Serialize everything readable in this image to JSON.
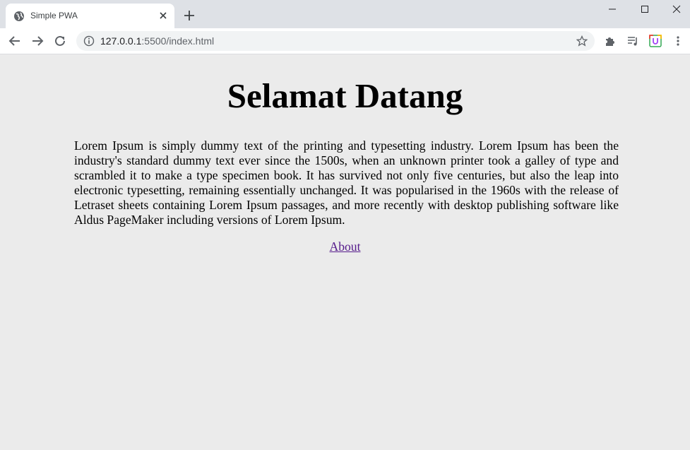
{
  "browser": {
    "tab": {
      "title": "Simple PWA",
      "favicon": "globe-icon"
    },
    "address_bar": {
      "host": "127.0.0.1",
      "rest": ":5500/index.html"
    },
    "icons": [
      "back-arrow-icon",
      "forward-arrow-icon",
      "reload-icon",
      "info-icon",
      "star-icon",
      "extensions-icon",
      "media-queue-icon",
      "extension-badge-icon",
      "kebab-menu-icon",
      "minimize-icon",
      "maximize-icon",
      "close-icon",
      "plus-icon"
    ]
  },
  "page": {
    "heading": "Selamat Datang",
    "paragraph": "Lorem Ipsum is simply dummy text of the printing and typesetting industry. Lorem Ipsum has been the industry's standard dummy text ever since the 1500s, when an unknown printer took a galley of type and scrambled it to make a type specimen book. It has survived not only five centuries, but also the leap into electronic typesetting, remaining essentially unchanged. It was popularised in the 1960s with the release of Letraset sheets containing Lorem Ipsum passages, and more recently with desktop publishing software like Aldus PageMaker including versions of Lorem Ipsum.",
    "link_label": "About"
  },
  "colors": {
    "page_bg": "#ebebeb",
    "link": "#551a8b",
    "chrome_frame": "#dee1e6"
  }
}
